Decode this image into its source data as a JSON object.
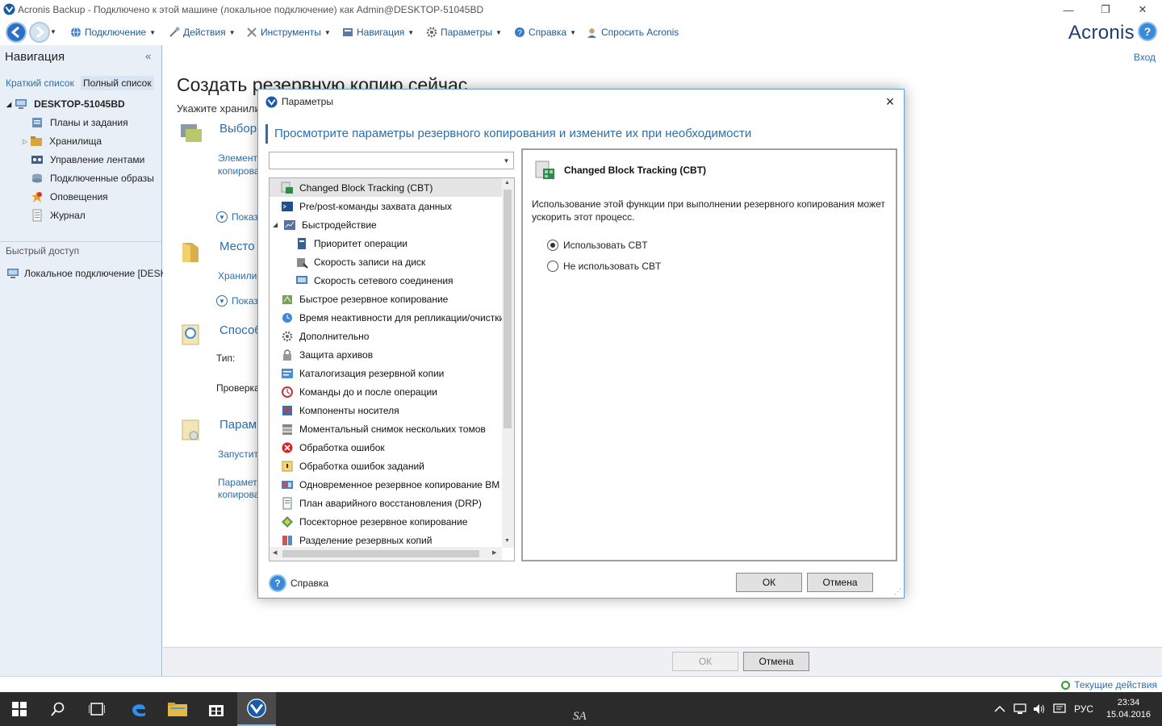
{
  "window": {
    "title": "Acronis Backup - Подключено к этой машине (локальное подключение) как Admin@DESKTOP-51045BD"
  },
  "toolbar": {
    "menus": [
      {
        "label": "Подключение",
        "icon": "globe-icon"
      },
      {
        "label": "Действия",
        "icon": "actions-icon"
      },
      {
        "label": "Инструменты",
        "icon": "tools-icon"
      },
      {
        "label": "Навигация",
        "icon": "navigation-icon"
      },
      {
        "label": "Параметры",
        "icon": "gear-icon"
      },
      {
        "label": "Справка",
        "icon": "help-icon"
      }
    ],
    "ask_label": "Спросить Acronis",
    "logo": "Acronis",
    "help_glyph": "?"
  },
  "nav": {
    "header": "Навигация",
    "collapse": "«",
    "tab_short": "Краткий список",
    "tab_full": "Полный список",
    "machine": "DESKTOP-51045BD",
    "items": [
      "Планы и задания",
      "Хранилища",
      "Управление лентами",
      "Подключенные образы",
      "Оповещения",
      "Журнал"
    ],
    "quick_access": "Быстрый доступ",
    "local_connection": "Локальное подключение [DESK"
  },
  "main": {
    "title": "Создать резервную копию сейчас",
    "subtitle": "Укажите хранили",
    "login": "Вход",
    "section_select": "Выбор",
    "link_elements_1": "Элемент",
    "link_elements_2": "копирова",
    "show_more": "Показ",
    "section_place": "Место",
    "link_storage": "Хранили",
    "section_method": "Способ",
    "label_type": "Тип:",
    "label_check": "Проверка",
    "section_params": "Парам",
    "link_run": "Запустит",
    "link_params_1": "Парамет",
    "link_params_2": "копирова",
    "ok": "ОК",
    "cancel": "Отмена"
  },
  "status": {
    "current_actions": "Текущие действия"
  },
  "dialog": {
    "title": "Параметры",
    "close": "×",
    "header": "Просмотрите параметры резервного копирования и измените их при необходимости",
    "options": [
      {
        "label": "Changed Block Tracking (CBT)",
        "indent": 0,
        "selected": true,
        "icon": "cbt-icon"
      },
      {
        "label": "Pre/post-команды захвата данных",
        "indent": 0,
        "icon": "console-icon"
      },
      {
        "label": "Быстродействие",
        "indent": 0,
        "expanded": true,
        "icon": "performance-icon"
      },
      {
        "label": "Приоритет операции",
        "indent": 1,
        "icon": "priority-icon"
      },
      {
        "label": "Скорость записи на диск",
        "indent": 1,
        "icon": "disk-speed-icon"
      },
      {
        "label": "Скорость сетевого соединения",
        "indent": 1,
        "icon": "network-speed-icon"
      },
      {
        "label": "Быстрое резервное копирование",
        "indent": 0,
        "icon": "fast-backup-icon"
      },
      {
        "label": "Время неактивности для репликации/очистки",
        "indent": 0,
        "icon": "inactivity-time-icon"
      },
      {
        "label": "Дополнительно",
        "indent": 0,
        "icon": "additional-gear-icon"
      },
      {
        "label": "Защита архивов",
        "indent": 0,
        "icon": "lock-icon"
      },
      {
        "label": "Каталогизация резервной копии",
        "indent": 0,
        "icon": "catalog-icon"
      },
      {
        "label": "Команды до и после операции",
        "indent": 0,
        "icon": "commands-icon"
      },
      {
        "label": "Компоненты носителя",
        "indent": 0,
        "icon": "media-components-icon"
      },
      {
        "label": "Моментальный снимок нескольких томов",
        "indent": 0,
        "icon": "snapshot-icon"
      },
      {
        "label": "Обработка ошибок",
        "indent": 0,
        "icon": "error-icon"
      },
      {
        "label": "Обработка ошибок заданий",
        "indent": 0,
        "icon": "task-error-icon"
      },
      {
        "label": "Одновременное резервное копирование ВМ",
        "indent": 0,
        "icon": "vm-icon"
      },
      {
        "label": "План аварийного восстановления (DRP)",
        "indent": 0,
        "icon": "drp-icon"
      },
      {
        "label": "Посекторное резервное копирование",
        "indent": 0,
        "icon": "sector-icon"
      },
      {
        "label": "Разделение резервных копий",
        "indent": 0,
        "icon": "split-icon"
      }
    ],
    "panel_title": "Changed Block Tracking (CBT)",
    "panel_desc": "Использование этой функции при выполнении резервного копирования может ускорить этот процесс.",
    "radio_use": "Использовать CBT",
    "radio_nouse": "Не использовать CBT",
    "radio_selected": "use",
    "help": "Справка",
    "ok": "ОК",
    "cancel": "Отмена"
  },
  "taskbar": {
    "watermark": "SA",
    "lang": "РУС",
    "time": "23:34",
    "date": "15.04.2016"
  }
}
